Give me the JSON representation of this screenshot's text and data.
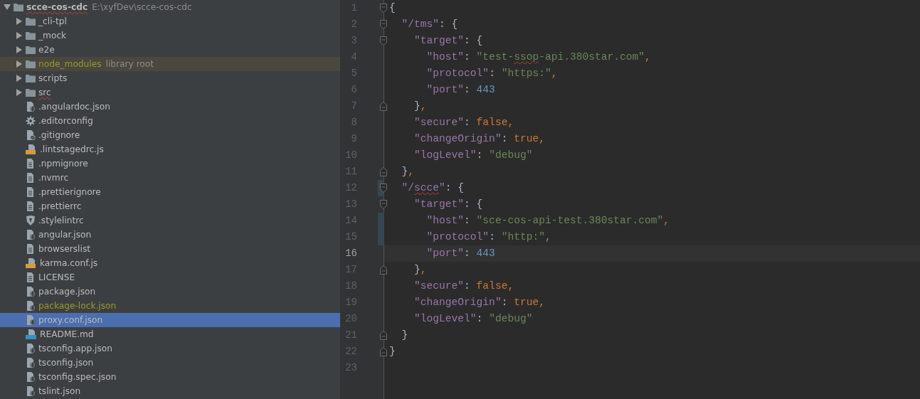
{
  "project_tree": {
    "name": "scce-cos-cdc",
    "path": "E:\\xyfDev\\scce-cos-cdc",
    "expanded": true,
    "typo": true,
    "children": [
      {
        "kind": "folder",
        "name": "_cli-tpl",
        "expanded": false,
        "selected": false
      },
      {
        "kind": "folder",
        "name": "_mock",
        "expanded": false,
        "selected": false
      },
      {
        "kind": "folder",
        "name": "e2e",
        "expanded": false,
        "selected": false
      },
      {
        "kind": "folder",
        "name": "node_modules",
        "note": "library root",
        "excluded": true,
        "expanded": false,
        "selected": false
      },
      {
        "kind": "folder",
        "name": "scripts",
        "expanded": false,
        "selected": false
      },
      {
        "kind": "folder",
        "name": "src",
        "typo": true,
        "expanded": false,
        "selected": false
      },
      {
        "kind": "json",
        "name": ".angulardoc.json",
        "selected": false
      },
      {
        "kind": "config",
        "name": ".editorconfig",
        "selected": false
      },
      {
        "kind": "ignore",
        "name": ".gitignore",
        "selected": false
      },
      {
        "kind": "js",
        "name": ".lintstagedrc.js",
        "selected": false
      },
      {
        "kind": "text",
        "name": ".npmignore",
        "selected": false
      },
      {
        "kind": "text",
        "name": ".nvmrc",
        "selected": false
      },
      {
        "kind": "text",
        "name": ".prettierignore",
        "selected": false
      },
      {
        "kind": "text",
        "name": ".prettierrc",
        "selected": false
      },
      {
        "kind": "shield",
        "name": ".stylelintrc",
        "selected": false
      },
      {
        "kind": "json",
        "name": "angular.json",
        "selected": false
      },
      {
        "kind": "text",
        "name": "browserslist",
        "selected": false
      },
      {
        "kind": "js",
        "name": "karma.conf.js",
        "selected": false
      },
      {
        "kind": "text",
        "name": "LICENSE",
        "selected": false
      },
      {
        "kind": "json",
        "name": "package.json",
        "selected": false
      },
      {
        "kind": "json",
        "name": "package-lock.json",
        "excluded": true,
        "selected": false
      },
      {
        "kind": "json",
        "name": "proxy.conf.json",
        "selected": true
      },
      {
        "kind": "md",
        "name": "README.md",
        "selected": false
      },
      {
        "kind": "json",
        "name": "tsconfig.app.json",
        "selected": false
      },
      {
        "kind": "json",
        "name": "tsconfig.json",
        "selected": false
      },
      {
        "kind": "json",
        "name": "tsconfig.spec.json",
        "selected": false
      },
      {
        "kind": "json",
        "name": "tslint.json",
        "selected": false
      }
    ]
  },
  "editor": {
    "lines": [
      {
        "number": "1",
        "fold_start": true,
        "tokens": [
          {
            "kind": "punct",
            "text": "{"
          }
        ]
      },
      {
        "number": "2",
        "fold_start": true,
        "tokens": [
          {
            "kind": "key",
            "text": "  \"/tms\""
          },
          {
            "kind": "punct",
            "text": ": {"
          }
        ]
      },
      {
        "number": "3",
        "fold_start": true,
        "tokens": [
          {
            "kind": "key",
            "text": "    \"target\""
          },
          {
            "kind": "punct",
            "text": ": {"
          }
        ]
      },
      {
        "number": "4",
        "tokens": [
          {
            "kind": "key",
            "text": "      \"host\""
          },
          {
            "kind": "punct",
            "text": ": "
          },
          {
            "kind": "string",
            "text": "\"test-"
          },
          {
            "kind": "string",
            "text": "ssop",
            "typo": true
          },
          {
            "kind": "string",
            "text": "-api.380star.com\""
          },
          {
            "kind": "keyword",
            "text": ","
          }
        ]
      },
      {
        "number": "5",
        "tokens": [
          {
            "kind": "key",
            "text": "      \"protocol\""
          },
          {
            "kind": "punct",
            "text": ": "
          },
          {
            "kind": "string",
            "text": "\"https:\""
          },
          {
            "kind": "keyword",
            "text": ","
          }
        ]
      },
      {
        "number": "6",
        "tokens": [
          {
            "kind": "key",
            "text": "      \"port\""
          },
          {
            "kind": "punct",
            "text": ": "
          },
          {
            "kind": "number",
            "text": "443"
          }
        ]
      },
      {
        "number": "7",
        "fold_end": true,
        "tokens": [
          {
            "kind": "punct",
            "text": "    }"
          },
          {
            "kind": "keyword",
            "text": ","
          }
        ]
      },
      {
        "number": "8",
        "tokens": [
          {
            "kind": "key",
            "text": "    \"secure\""
          },
          {
            "kind": "punct",
            "text": ": "
          },
          {
            "kind": "keyword",
            "text": "false,"
          }
        ]
      },
      {
        "number": "9",
        "tokens": [
          {
            "kind": "key",
            "text": "    \"changeOrigin\""
          },
          {
            "kind": "punct",
            "text": ": "
          },
          {
            "kind": "keyword",
            "text": "true,"
          }
        ]
      },
      {
        "number": "10",
        "tokens": [
          {
            "kind": "key",
            "text": "    \"logLevel\""
          },
          {
            "kind": "punct",
            "text": ": "
          },
          {
            "kind": "string",
            "text": "\"debug\""
          }
        ]
      },
      {
        "number": "11",
        "fold_end": true,
        "tokens": [
          {
            "kind": "punct",
            "text": "  }"
          },
          {
            "kind": "keyword",
            "text": ","
          }
        ]
      },
      {
        "number": "12",
        "fold_start": true,
        "changed": true,
        "tokens": [
          {
            "kind": "key",
            "text": "  \"/"
          },
          {
            "kind": "key",
            "text": "scce",
            "typo": true
          },
          {
            "kind": "key",
            "text": "\""
          },
          {
            "kind": "punct",
            "text": ": {"
          }
        ]
      },
      {
        "number": "13",
        "fold_start": true,
        "tokens": [
          {
            "kind": "key",
            "text": "    \"target\""
          },
          {
            "kind": "punct",
            "text": ": {"
          }
        ]
      },
      {
        "number": "14",
        "changed": true,
        "tokens": [
          {
            "kind": "key",
            "text": "      \"host\""
          },
          {
            "kind": "punct",
            "text": ": "
          },
          {
            "kind": "string",
            "text": "\"sce-cos-api-test.380star.com\""
          },
          {
            "kind": "keyword",
            "text": ","
          }
        ]
      },
      {
        "number": "15",
        "changed": true,
        "tokens": [
          {
            "kind": "key",
            "text": "      \"protocol\""
          },
          {
            "kind": "punct",
            "text": ": "
          },
          {
            "kind": "string",
            "text": "\"http:\""
          },
          {
            "kind": "keyword",
            "text": ","
          }
        ]
      },
      {
        "number": "16",
        "current": true,
        "tokens": [
          {
            "kind": "key",
            "text": "      \"port\""
          },
          {
            "kind": "punct",
            "text": ": "
          },
          {
            "kind": "number",
            "text": "443"
          }
        ]
      },
      {
        "number": "17",
        "fold_end": true,
        "tokens": [
          {
            "kind": "punct",
            "text": "    }"
          },
          {
            "kind": "keyword",
            "text": ","
          }
        ]
      },
      {
        "number": "18",
        "tokens": [
          {
            "kind": "key",
            "text": "    \"secure\""
          },
          {
            "kind": "punct",
            "text": ": "
          },
          {
            "kind": "keyword",
            "text": "false,"
          }
        ]
      },
      {
        "number": "19",
        "tokens": [
          {
            "kind": "key",
            "text": "    \"changeOrigin\""
          },
          {
            "kind": "punct",
            "text": ": "
          },
          {
            "kind": "keyword",
            "text": "true,"
          }
        ]
      },
      {
        "number": "20",
        "tokens": [
          {
            "kind": "key",
            "text": "    \"logLevel\""
          },
          {
            "kind": "punct",
            "text": ": "
          },
          {
            "kind": "string",
            "text": "\"debug\""
          }
        ]
      },
      {
        "number": "21",
        "fold_end": true,
        "tokens": [
          {
            "kind": "punct",
            "text": "  }"
          }
        ]
      },
      {
        "number": "22",
        "fold_end": true,
        "tokens": [
          {
            "kind": "punct",
            "text": "}"
          }
        ]
      },
      {
        "number": "23"
      }
    ]
  }
}
